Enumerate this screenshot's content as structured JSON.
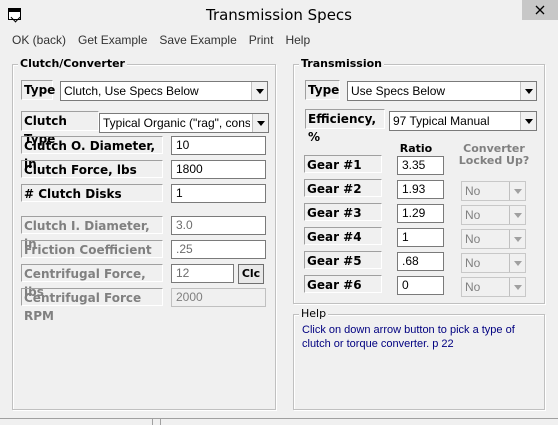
{
  "window": {
    "title": "Transmission Specs"
  },
  "menu": [
    "OK (back)",
    "Get Example",
    "Save Example",
    "Print",
    "Help"
  ],
  "clutch": {
    "group_title": "Clutch/Converter",
    "type_label": "Type",
    "type_value": "Clutch, Use Specs Below",
    "clutch_type_label": "Clutch Type",
    "clutch_type_value": "Typical Organic (\"rag\", constan",
    "outer_diameter_label": "Clutch O. Diameter, in",
    "outer_diameter_value": "10",
    "force_label": "Clutch Force, lbs",
    "force_value": "1800",
    "disks_label": "# Clutch Disks",
    "disks_value": "1",
    "inner_diameter_label": "Clutch I. Diameter, in",
    "inner_diameter_value": "3.0",
    "friction_label": "Friction Coefficient",
    "friction_value": ".25",
    "centrifugal_force_label": "Centrifugal Force, lbs",
    "centrifugal_force_value": "12",
    "clc_label": "Clc",
    "centrifugal_rpm_label": "Centrifugal Force RPM",
    "centrifugal_rpm_value": "2000"
  },
  "transmission": {
    "group_title": "Transmission",
    "type_label": "Type",
    "type_value": "Use Specs Below",
    "efficiency_label": "Efficiency, %",
    "efficiency_value": "97 Typical Manual",
    "ratio_header": "Ratio",
    "converter_header_1": "Converter",
    "converter_header_2": "Locked Up?",
    "gears": [
      {
        "label": "Gear #1",
        "ratio": "3.35",
        "locked": ""
      },
      {
        "label": "Gear #2",
        "ratio": "1.93",
        "locked": "No"
      },
      {
        "label": "Gear #3",
        "ratio": "1.29",
        "locked": "No"
      },
      {
        "label": "Gear #4",
        "ratio": "1",
        "locked": "No"
      },
      {
        "label": "Gear #5",
        "ratio": ".68",
        "locked": "No"
      },
      {
        "label": "Gear #6",
        "ratio": "0",
        "locked": "No"
      }
    ]
  },
  "help": {
    "group_title": "Help",
    "text": "Click on down arrow button to pick a type of clutch or torque converter.  p 22"
  },
  "icons": {
    "app": "window-icon",
    "close": "close-icon",
    "dropdown": "chevron-down-icon"
  }
}
